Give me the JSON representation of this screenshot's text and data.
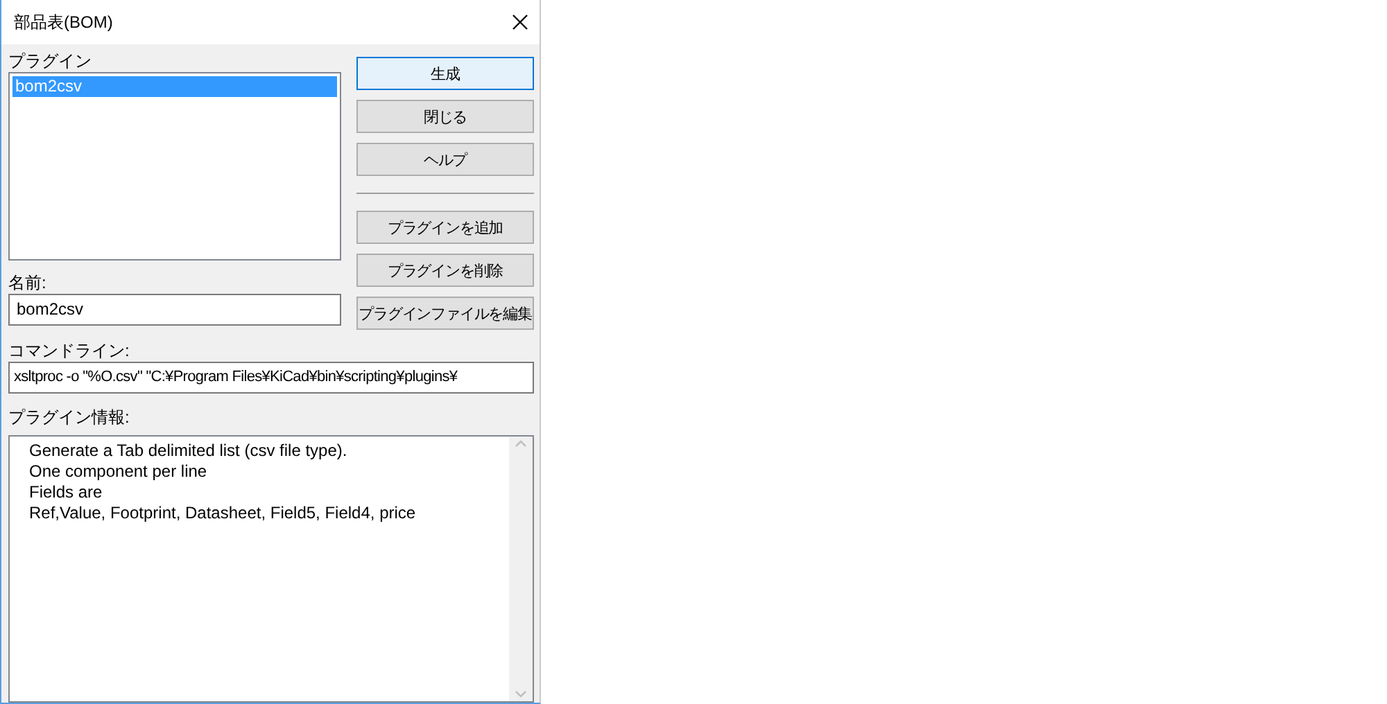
{
  "window": {
    "title": "部品表(BOM)"
  },
  "plugins": {
    "label": "プラグイン",
    "items": [
      {
        "label": "bom2csv",
        "selected": true
      }
    ]
  },
  "name": {
    "label": "名前:",
    "value": "bom2csv"
  },
  "command_line": {
    "label": "コマンドライン:",
    "value": "xsltproc -o \"%O.csv\" \"C:¥Program Files¥KiCad¥bin¥scripting¥plugins¥"
  },
  "plugin_info": {
    "label": "プラグイン情報:",
    "lines": [
      "Generate a Tab delimited list (csv file type).",
      "One component per line",
      "Fields are",
      "Ref,Value, Footprint, Datasheet, Field5, Field4, price"
    ]
  },
  "buttons": [
    {
      "label": "生成",
      "default": true
    },
    {
      "label": "閉じる",
      "default": false
    },
    {
      "label": "ヘルプ",
      "default": false
    }
  ],
  "plugin_buttons": [
    {
      "label": "プラグインを追加",
      "default": false
    },
    {
      "label": "プラグインを削除",
      "default": false
    },
    {
      "label": "プラグインファイルを編集",
      "default": false
    }
  ]
}
